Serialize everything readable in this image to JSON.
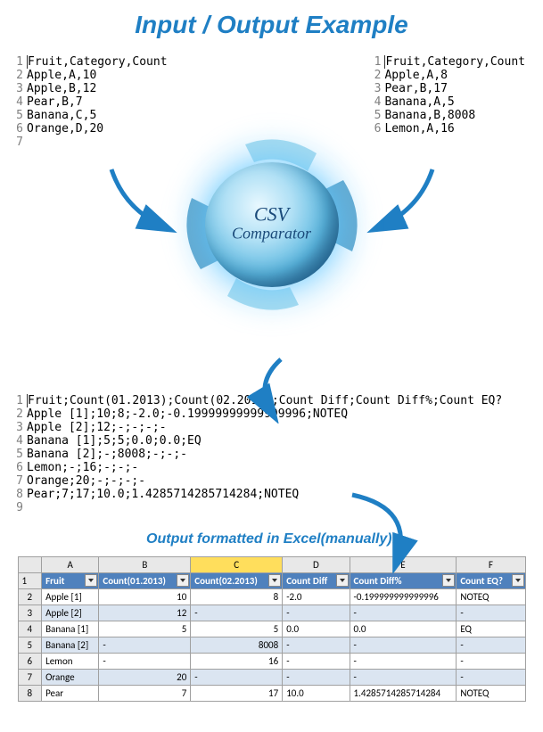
{
  "title": "Input / Output Example",
  "input_left": {
    "lines": [
      "Fruit,Category,Count",
      "Apple,A,10",
      "Apple,B,12",
      "Pear,B,7",
      "Banana,C,5",
      "Orange,D,20",
      ""
    ]
  },
  "input_right": {
    "lines": [
      "Fruit,Category,Count",
      "Apple,A,8",
      "Pear,B,17",
      "Banana,A,5",
      "Banana,B,8008",
      "Lemon,A,16"
    ]
  },
  "logo": {
    "line1": "CSV",
    "line2": "Comparator"
  },
  "output_csv": {
    "lines": [
      "Fruit;Count(01.2013);Count(02.2013);Count Diff;Count Diff%;Count EQ?",
      "Apple [1];10;8;-2.0;-0.19999999999999996;NOTEQ",
      "Apple [2];12;-;-;-;-",
      "Banana [1];5;5;0.0;0.0;EQ",
      "Banana [2];-;8008;-;-;-",
      "Lemon;-;16;-;-;-",
      "Orange;20;-;-;-;-",
      "Pear;7;17;10.0;1.4285714285714284;NOTEQ",
      ""
    ]
  },
  "subtitle": "Output formatted in Excel(manually):",
  "excel": {
    "columns": [
      "",
      "A",
      "B",
      "C",
      "D",
      "E",
      "F"
    ],
    "headers": [
      "Fruit",
      "Count(01.2013)",
      "Count(02.2013)",
      "Count Diff",
      "Count Diff%",
      "Count EQ?"
    ],
    "rows": [
      {
        "n": "2",
        "cells": [
          "Apple [1]",
          "10",
          "8",
          "-2.0",
          "-0.199999999999996",
          "NOTEQ"
        ]
      },
      {
        "n": "3",
        "cells": [
          "Apple [2]",
          "12",
          "-",
          "-",
          "-",
          "-"
        ]
      },
      {
        "n": "4",
        "cells": [
          "Banana [1]",
          "5",
          "5",
          "0.0",
          "0.0",
          "EQ"
        ]
      },
      {
        "n": "5",
        "cells": [
          "Banana [2]",
          "-",
          "8008",
          "-",
          "-",
          "-"
        ]
      },
      {
        "n": "6",
        "cells": [
          "Lemon",
          "-",
          "16",
          "-",
          "-",
          "-"
        ]
      },
      {
        "n": "7",
        "cells": [
          "Orange",
          "20",
          "-",
          "-",
          "-",
          "-"
        ]
      },
      {
        "n": "8",
        "cells": [
          "Pear",
          "7",
          "17",
          "10.0",
          "1.4285714285714284",
          "NOTEQ"
        ]
      }
    ]
  },
  "arrow_color": "#1F7FC4"
}
